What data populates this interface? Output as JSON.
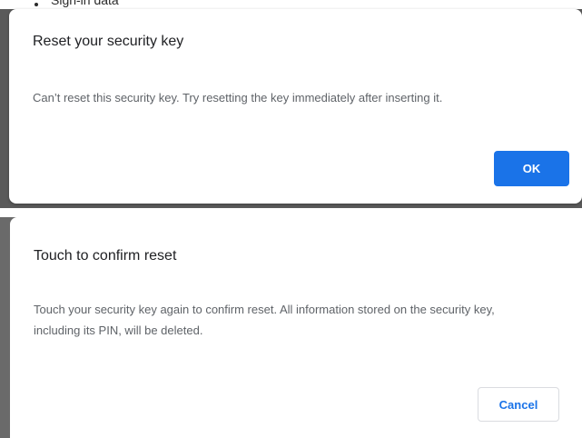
{
  "background_page": {
    "partial_text": "Sign-in data"
  },
  "reset_dialog": {
    "title": "Reset your security key",
    "message": "Can’t reset this security key. Try resetting the key immediately after inserting it.",
    "ok_label": "OK"
  },
  "confirm_dialog": {
    "title": "Touch to confirm reset",
    "message": "Touch your security key again to confirm reset. All information stored on the security key, including its PIN, will be deleted.",
    "cancel_label": "Cancel"
  },
  "colors": {
    "accent": "#1a73e8",
    "title_text": "#202124",
    "body_text": "#5f6368",
    "backdrop": "#5a5a5a"
  }
}
